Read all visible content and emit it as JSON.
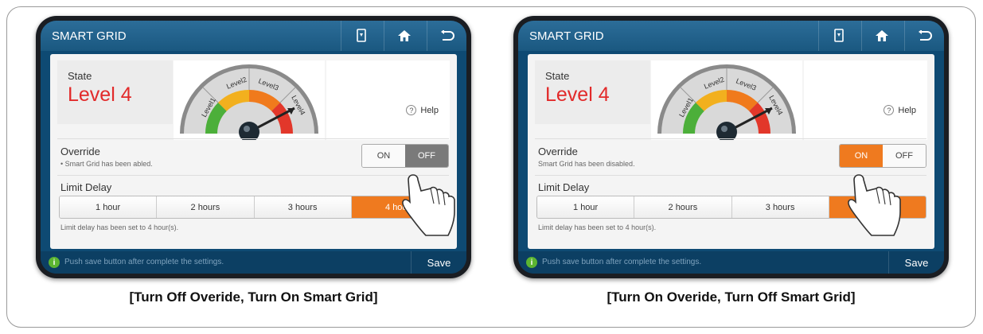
{
  "panels": [
    {
      "title": "SMART GRID",
      "state_label": "State",
      "state_value": "Level 4",
      "gauge": {
        "levels": [
          "Level1",
          "Level2",
          "Level3",
          "Level4"
        ],
        "current_level": 4
      },
      "help_label": "Help",
      "override_label": "Override",
      "override_message": "• Smart Grid has been abled.",
      "toggle_on_label": "ON",
      "toggle_off_label": "OFF",
      "toggle_state": "off",
      "limit_delay_label": "Limit Delay",
      "limit_options": [
        "1 hour",
        "2 hours",
        "3 hours",
        "4 hours"
      ],
      "limit_selected": "4 hours",
      "limit_message": "Limit delay has been set to 4 hour(s).",
      "footer_info": "Push save button after complete the settings.",
      "save_label": "Save",
      "caption": "[Turn Off Overide, Turn On Smart Grid]"
    },
    {
      "title": "SMART GRID",
      "state_label": "State",
      "state_value": "Level 4",
      "gauge": {
        "levels": [
          "Level1",
          "Level2",
          "Level3",
          "Level4"
        ],
        "current_level": 4
      },
      "help_label": "Help",
      "override_label": "Override",
      "override_message": "Smart Grid has been disabled.",
      "toggle_on_label": "ON",
      "toggle_off_label": "OFF",
      "toggle_state": "on",
      "limit_delay_label": "Limit Delay",
      "limit_options": [
        "1 hour",
        "2 hours",
        "3 hours",
        "4 hours"
      ],
      "limit_selected": "4 hours",
      "limit_message": "Limit delay has been set to 4 hour(s).",
      "footer_info": "Push save button after complete the settings.",
      "save_label": "Save",
      "caption": "[Turn On Overide, Turn Off Smart Grid]"
    }
  ],
  "icons": {
    "appliance": "smart-appliance-icon",
    "home": "home-icon",
    "back": "back-icon",
    "info": "info-icon",
    "hand": "hand-pointer-icon"
  },
  "colors": {
    "accent": "#ef7a1f",
    "state_red": "#e22a2a",
    "titlebar": "#1f5f8a",
    "info_green": "#5cb531"
  }
}
